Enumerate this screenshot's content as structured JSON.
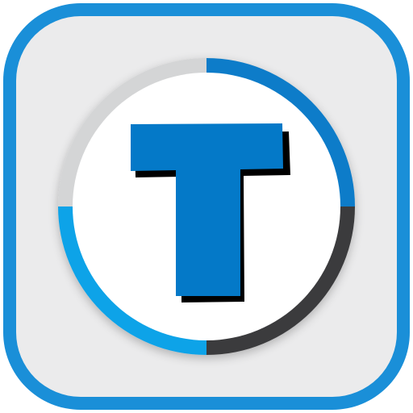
{
  "icon": {
    "letter": "T",
    "icon_name": "t-letter-app-icon",
    "colors": {
      "frame_blue": "#1A8FD8",
      "tile_gray": "#EBEBEC",
      "ring_light_gray": "#D4D5D6",
      "ring_blue": "#0B7CC9",
      "ring_dark": "#3B3B3D",
      "ring_cyan": "#0FA3E8",
      "circle_white": "#FFFFFF",
      "letter_blue": "#0479C8",
      "letter_shadow": "#000000"
    }
  }
}
